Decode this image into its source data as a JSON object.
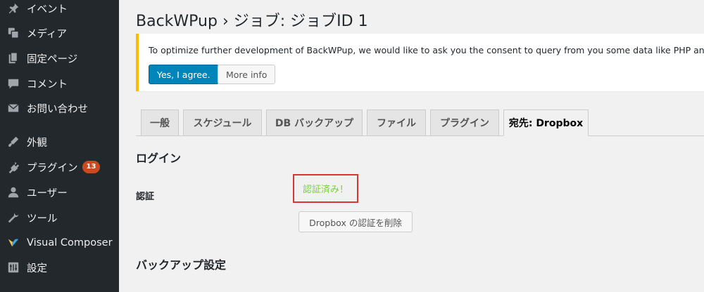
{
  "sidebar": {
    "items": [
      {
        "label": "イベント",
        "icon": "pin-icon"
      },
      {
        "label": "メディア",
        "icon": "media-icon"
      },
      {
        "label": "固定ページ",
        "icon": "page-icon"
      },
      {
        "label": "コメント",
        "icon": "comment-icon"
      },
      {
        "label": "お問い合わせ",
        "icon": "mail-icon"
      },
      {
        "label": "外観",
        "icon": "appearance-icon"
      },
      {
        "label": "プラグイン",
        "icon": "plugin-icon",
        "badge": "13"
      },
      {
        "label": "ユーザー",
        "icon": "user-icon"
      },
      {
        "label": "ツール",
        "icon": "tools-icon"
      },
      {
        "label": "Visual Composer",
        "icon": "visual-composer-icon"
      },
      {
        "label": "設定",
        "icon": "settings-icon"
      }
    ]
  },
  "header": {
    "title": "BackWPup › ジョブ: ジョブID 1"
  },
  "notice": {
    "text": "To optimize further development of BackWPup, we would like to ask you the consent to query from you some data like PHP and W",
    "agree_label": "Yes, I agree.",
    "more_label": "More info",
    "border_color": "#ffba00"
  },
  "tabs": [
    {
      "label": "一般"
    },
    {
      "label": "スケジュール"
    },
    {
      "label": "DB バックアップ"
    },
    {
      "label": "ファイル"
    },
    {
      "label": "プラグイン"
    },
    {
      "label": "宛先: Dropbox",
      "active": true
    }
  ],
  "login": {
    "title": "ログイン",
    "auth_label": "認証",
    "auth_status": "認証済み！",
    "status_color": "#7ad03a",
    "delete_label": "Dropbox の認証を削除"
  },
  "backup": {
    "title": "バックアップ設定"
  },
  "colors": {
    "sidebar_bg": "#23282d",
    "primary": "#0085ba",
    "highlight_border": "#d63638",
    "badge": "#ca4a1f"
  }
}
